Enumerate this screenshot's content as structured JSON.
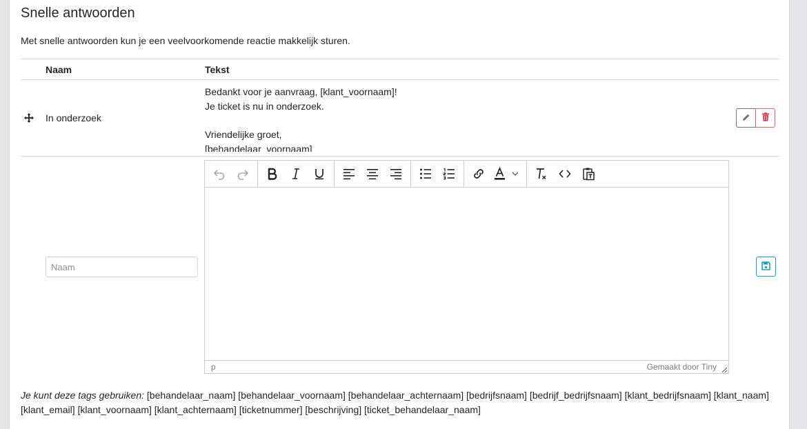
{
  "page": {
    "title": "Snelle antwoorden",
    "subtitle": "Met snelle antwoorden kun je een veelvoorkomende reactie makkelijk sturen."
  },
  "table": {
    "columns": [
      "Naam",
      "Tekst"
    ],
    "rows": [
      {
        "name": "In onderzoek",
        "text": "Bedankt voor je aanvraag, [klant_voornaam]!\nJe ticket is nu in onderzoek.\n\nVriendelijke groet,\n[behandelaar_voornaam]"
      }
    ]
  },
  "new_row": {
    "name_placeholder": "Naam"
  },
  "editor": {
    "toolbar_icons": [
      "undo-icon",
      "redo-icon",
      "bold-icon",
      "italic-icon",
      "underline-icon",
      "align-left-icon",
      "align-center-icon",
      "align-right-icon",
      "bullet-list-icon",
      "numbered-list-icon",
      "link-icon",
      "text-color-icon",
      "clear-format-icon",
      "source-code-icon",
      "paste-text-icon"
    ],
    "status_path": "p",
    "brand": "Gemaakt door Tiny"
  },
  "tags": {
    "label": "Je kunt deze tags gebruiken:",
    "list": "[behandelaar_naam] [behandelaar_voornaam] [behandelaar_achternaam] [bedrijfsnaam] [bedrijf_bedrijfsnaam] [klant_bedrijfsnaam] [klant_naam] [klant_email] [klant_voornaam] [klant_achternaam] [ticketnummer] [beschrijving] [ticket_behandelaar_naam]"
  },
  "colors": {
    "edit": "#6c757d",
    "delete": "#dc3545",
    "save": "#17a2b8",
    "text_color_bar": "#222222"
  }
}
